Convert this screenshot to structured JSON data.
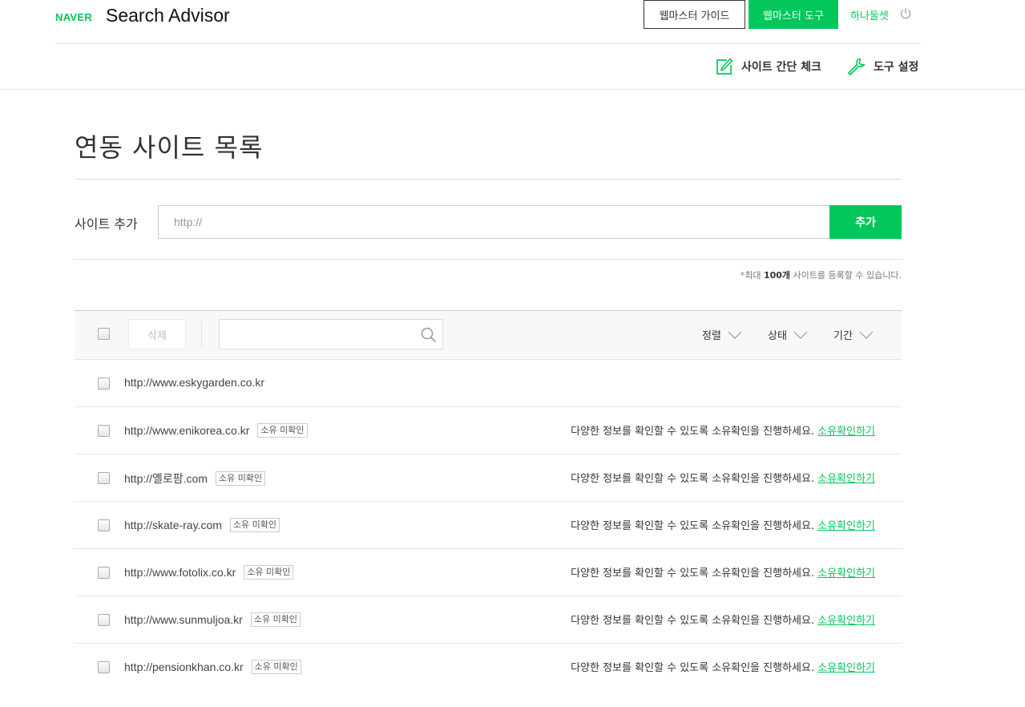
{
  "header": {
    "logo": "NAVER",
    "title": "Search Advisor",
    "guide_button": "웹마스터 가이드",
    "tools_button": "웹마스터 도구",
    "user_name": "하나둘셋",
    "sub_nav": {
      "check_label": "사이트 간단 체크",
      "settings_label": "도구 설정"
    }
  },
  "main": {
    "page_title": "연동 사이트 목록",
    "add_site": {
      "label": "사이트 추가",
      "placeholder": "http://",
      "button": "추가",
      "note_prefix": "*최대 ",
      "note_bold": "100개",
      "note_suffix": " 사이트를 등록할 수 있습니다."
    },
    "toolbar": {
      "delete_button": "삭제",
      "search_placeholder": "",
      "filters": [
        "정렬",
        "상태",
        "기간"
      ]
    },
    "sites": [
      {
        "url": "http://www.eskygarden.co.kr",
        "badge": "",
        "message": "",
        "link": ""
      },
      {
        "url": "http://www.enikorea.co.kr",
        "badge": "소유 미확인",
        "message": "다양한 정보를 확인할 수 있도록 소유확인을 진행하세요.",
        "link": "소유확인하기"
      },
      {
        "url": "http://옐로팜.com",
        "badge": "소유 미확인",
        "message": "다양한 정보를 확인할 수 있도록 소유확인을 진행하세요.",
        "link": "소유확인하기"
      },
      {
        "url": "http://skate-ray.com",
        "badge": "소유 미확인",
        "message": "다양한 정보를 확인할 수 있도록 소유확인을 진행하세요.",
        "link": "소유확인하기"
      },
      {
        "url": "http://www.fotolix.co.kr",
        "badge": "소유 미확인",
        "message": "다양한 정보를 확인할 수 있도록 소유확인을 진행하세요.",
        "link": "소유확인하기"
      },
      {
        "url": "http://www.sunmuljoa.kr",
        "badge": "소유 미확인",
        "message": "다양한 정보를 확인할 수 있도록 소유확인을 진행하세요.",
        "link": "소유확인하기"
      },
      {
        "url": "http://pensionkhan.co.kr",
        "badge": "소유 미확인",
        "message": "다양한 정보를 확인할 수 있도록 소유확인을 진행하세요.",
        "link": "소유확인하기"
      }
    ]
  },
  "colors": {
    "brand_green": "#03c75a",
    "text_dark": "#333333"
  }
}
